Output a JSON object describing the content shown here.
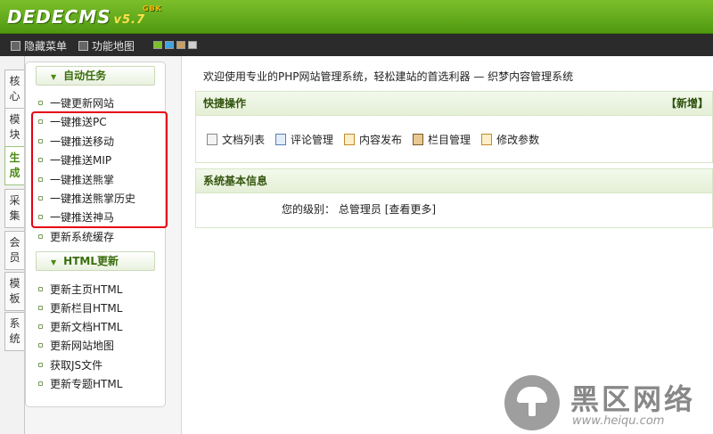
{
  "header": {
    "logo": "DEDECMS",
    "version": "v5.7",
    "version_sup": "GBK"
  },
  "toolbar": {
    "hide_menu": "隐藏菜单",
    "site_map": "功能地图",
    "skin_colors": [
      "#7cbf2a",
      "#3fa3e0",
      "#c9a063",
      "#cfcfcf"
    ]
  },
  "side_tabs": [
    "核心",
    "模块",
    "生成",
    "采集",
    "会员",
    "模板",
    "系统"
  ],
  "menu": {
    "cat1": "自动任务",
    "cat1_items": [
      "一键更新网站",
      "一键推送PC",
      "一键推送移动",
      "一键推送MIP",
      "一键推送熊掌",
      "一键推送熊掌历史",
      "一键推送神马",
      "更新系统缓存"
    ],
    "cat2": "HTML更新",
    "cat2_items": [
      "更新主页HTML",
      "更新栏目HTML",
      "更新文档HTML",
      "更新网站地图",
      "获取JS文件",
      "更新专题HTML"
    ]
  },
  "main": {
    "welcome": "欢迎使用专业的PHP网站管理系统，轻松建站的首选利器 — 织梦内容管理系统",
    "quick_title": "快捷操作",
    "quick_add": "【新增】",
    "quick_items": [
      "文档列表",
      "评论管理",
      "内容发布",
      "栏目管理",
      "修改参数"
    ],
    "info_title": "系统基本信息",
    "level_label": "您的级别：",
    "level_value": "总管理员",
    "see_more": "[查看更多]"
  },
  "watermark": {
    "title": "黑区网络",
    "url": "www.heiqu.com"
  }
}
